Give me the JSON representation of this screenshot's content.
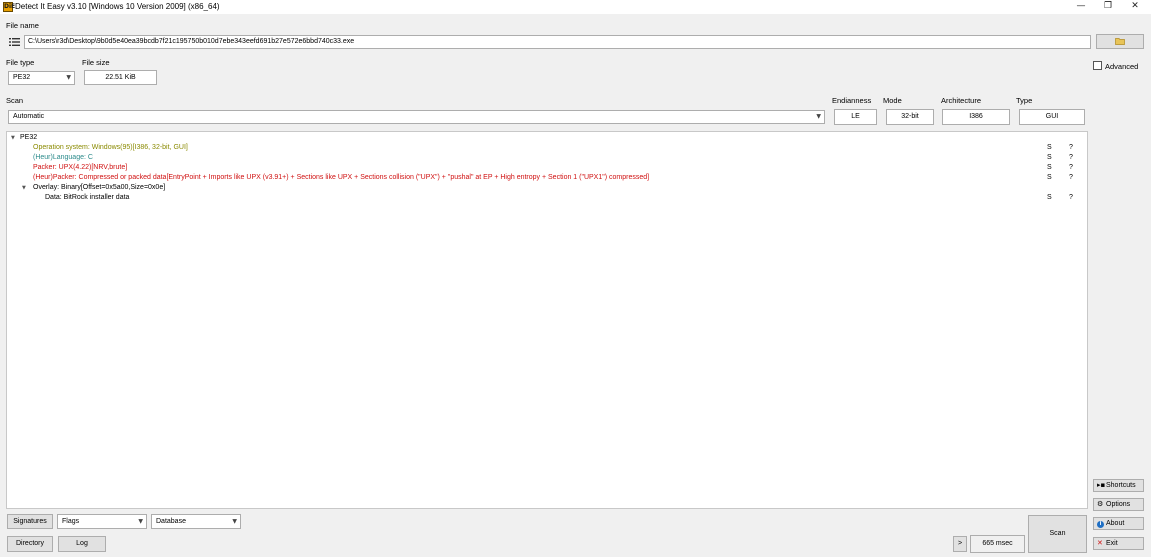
{
  "window": {
    "title": "Detect It Easy v3.10 [Windows 10 Version 2009] (x86_64)",
    "app_icon_text": "DiE",
    "minimize": "—",
    "maximize": "❐",
    "close": "✕"
  },
  "file": {
    "label": "File name",
    "path": "C:\\Users\\r3d\\Desktop\\9b0d5e40ea39bcdb7f21c195750b010d7ebe343eefd691b27e572e6bbd740c33.exe",
    "browse_icon": "📁"
  },
  "filetype": {
    "label": "File type",
    "value": "PE32"
  },
  "filesize": {
    "label": "File size",
    "value": "22.51 KiB"
  },
  "advanced": {
    "label": "Advanced",
    "checked": false
  },
  "scan": {
    "label": "Scan",
    "mode_value": "Automatic",
    "endianness_label": "Endianness",
    "endianness_value": "LE",
    "mode_label": "Mode",
    "mode_field_value": "32-bit",
    "architecture_label": "Architecture",
    "architecture_value": "I386",
    "type_label": "Type",
    "type_value": "GUI"
  },
  "results": {
    "root": "PE32",
    "items": [
      {
        "text": "Operation system: Windows(95)[I386, 32-bit, GUI]",
        "color": "#8a8a00",
        "s": "S",
        "q": "?"
      },
      {
        "text": "(Heur)Language: C",
        "color": "#2a8a8a",
        "s": "S",
        "q": "?"
      },
      {
        "text": "Packer: UPX(4.22)[NRV,brute]",
        "color": "#d01010",
        "s": "S",
        "q": "?"
      },
      {
        "text": "(Heur)Packer: Compressed or packed data[EntryPoint + Imports like UPX (v3.91+) + Sections like UPX + Sections collision (\"UPX\") + \"pushal\" at EP + High entropy + Section 1 (\"UPX1\") compressed]",
        "color": "#d01010",
        "s": "S",
        "q": "?"
      }
    ],
    "overlay": "Overlay: Binary[Offset=0x5a00,Size=0x0e]",
    "overlay_child": {
      "text": "Data: BitRock installer data",
      "s": "S",
      "q": "?"
    }
  },
  "bottom": {
    "signatures": "Signatures",
    "flags": "Flags",
    "database": "Database",
    "directory": "Directory",
    "log": "Log",
    "more": ">",
    "time": "665 msec",
    "scan_button": "Scan"
  },
  "side": {
    "shortcuts": "Shortcuts",
    "options": "Options",
    "about": "About",
    "exit": "Exit"
  },
  "icons": {
    "shortcuts": "keyboard-icon",
    "options": "gear-icon",
    "about": "info-icon",
    "exit": "close-icon"
  }
}
